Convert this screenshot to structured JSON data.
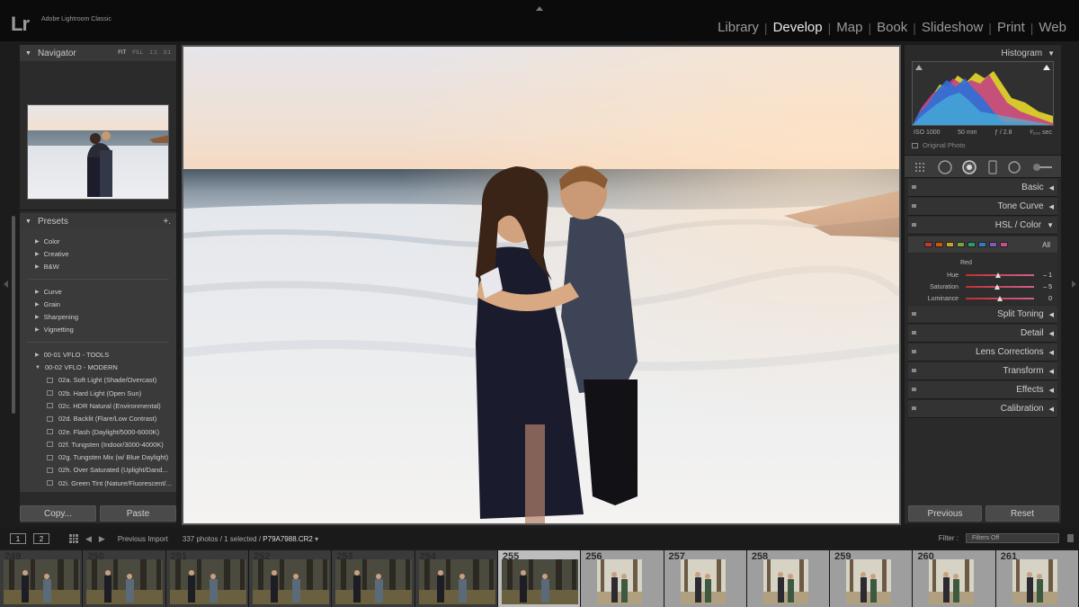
{
  "app": {
    "logo": "Lr",
    "name": "Adobe Lightroom Classic"
  },
  "modules": [
    {
      "label": "Library",
      "active": false
    },
    {
      "label": "Develop",
      "active": true
    },
    {
      "label": "Map",
      "active": false
    },
    {
      "label": "Book",
      "active": false
    },
    {
      "label": "Slideshow",
      "active": false
    },
    {
      "label": "Print",
      "active": false
    },
    {
      "label": "Web",
      "active": false
    }
  ],
  "navigator": {
    "title": "Navigator",
    "zoom_options": [
      "FIT",
      "FILL",
      "1:1",
      "3:1"
    ],
    "zoom_selected": "FIT"
  },
  "presets": {
    "title": "Presets",
    "add_label": "+.",
    "groups_a": [
      "Color",
      "Creative",
      "B&W"
    ],
    "groups_b": [
      "Curve",
      "Grain",
      "Sharpening",
      "Vignetting"
    ],
    "groups_c": [
      "00-01 VFLO - TOOLS",
      "00-02 VFLO - MODERN"
    ],
    "items": [
      "02a. Soft Light (Shade/Overcast)",
      "02b. Hard Light (Open Sun)",
      "02c. HDR Natural (Environmental)",
      "02d. Backlit (Flare/Low Contrast)",
      "02e. Flash (Daylight/5000-6000K)",
      "02f. Tungsten (Indoor/3000-4000K)",
      "02g. Tungsten Mix (w/ Blue Daylight)",
      "02h. Over Saturated (Uplight/Dand...",
      "02i. Green Tint (Nature/Fluorescent/..."
    ]
  },
  "left_buttons": {
    "copy": "Copy...",
    "paste": "Paste"
  },
  "histogram": {
    "title": "Histogram",
    "iso": "ISO 1000",
    "focal": "50 mm",
    "aperture": "ƒ / 2.8",
    "shutter": "¹⁄₂₀₀ sec",
    "original_photo": "Original Photo"
  },
  "tools": [
    "grid-tool-icon",
    "crop-icon",
    "spot-removal-icon",
    "red-eye-icon",
    "graduated-filter-icon",
    "adjustment-brush-icon"
  ],
  "sections_top": [
    "Basic",
    "Tone Curve"
  ],
  "hsl": {
    "title": "HSL / Color",
    "all_label": "All",
    "swatches": [
      "#c0392b",
      "#d35400",
      "#c9a227",
      "#7da23a",
      "#2e9c6a",
      "#2f7fc0",
      "#7b5bbf",
      "#c04f8f"
    ],
    "channel": "Red",
    "sliders": [
      {
        "label": "Hue",
        "value": "– 1",
        "pos": 0.48
      },
      {
        "label": "Saturation",
        "value": "– 5",
        "pos": 0.46
      },
      {
        "label": "Luminance",
        "value": "0",
        "pos": 0.5
      }
    ]
  },
  "sections_bottom": [
    "Split Toning",
    "Detail",
    "Lens Corrections",
    "Transform",
    "Effects",
    "Calibration"
  ],
  "right_buttons": {
    "previous": "Previous",
    "reset": "Reset"
  },
  "filmbar": {
    "page1": "1",
    "page2": "2",
    "source": "Previous Import",
    "count": "337 photos / 1 selected /",
    "filename": "P79A7988.CR2",
    "filter_label": "Filter :",
    "filter_value": "Filters Off"
  },
  "filmstrip": [
    {
      "num": "249",
      "style": "dark"
    },
    {
      "num": "250",
      "style": "dark"
    },
    {
      "num": "251",
      "style": "dark"
    },
    {
      "num": "252",
      "style": "dark"
    },
    {
      "num": "253",
      "style": "dark"
    },
    {
      "num": "254",
      "style": "dark"
    },
    {
      "num": "255",
      "style": "sel"
    },
    {
      "num": "256",
      "style": "light"
    },
    {
      "num": "257",
      "style": "light"
    },
    {
      "num": "258",
      "style": "light"
    },
    {
      "num": "259",
      "style": "light"
    },
    {
      "num": "260",
      "style": "light"
    },
    {
      "num": "261",
      "style": "light"
    }
  ]
}
